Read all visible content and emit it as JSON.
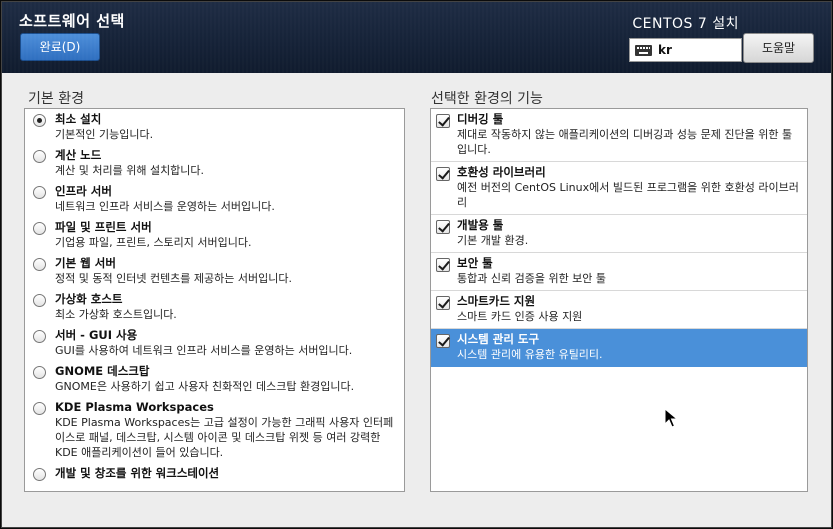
{
  "header": {
    "title": "소프트웨어 선택",
    "done_label": "완료(D)",
    "product": "CENTOS 7 설치",
    "keyboard_layout": "kr",
    "help_label": "도움말"
  },
  "environment": {
    "title": "기본 환경",
    "items": [
      {
        "name": "최소 설치",
        "desc": "기본적인 기능입니다.",
        "selected": true
      },
      {
        "name": "계산 노드",
        "desc": "계산 및 처리를 위해 설치합니다.",
        "selected": false
      },
      {
        "name": "인프라 서버",
        "desc": "네트워크 인프라 서비스를 운영하는 서버입니다.",
        "selected": false
      },
      {
        "name": "파일 및 프린트 서버",
        "desc": "기업용 파일, 프린트, 스토리지 서버입니다.",
        "selected": false
      },
      {
        "name": "기본 웹 서버",
        "desc": "정적 및 동적 인터넷 컨텐츠를 제공하는 서버입니다.",
        "selected": false
      },
      {
        "name": "가상화 호스트",
        "desc": "최소 가상화 호스트입니다.",
        "selected": false
      },
      {
        "name": "서버 - GUI 사용",
        "desc": "GUI를 사용하여 네트워크 인프라 서비스를 운영하는 서버입니다.",
        "selected": false
      },
      {
        "name": "GNOME 데스크탑",
        "desc": "GNOME은 사용하기 쉽고 사용자 친화적인 데스크탑 환경입니다.",
        "selected": false
      },
      {
        "name": "KDE Plasma Workspaces",
        "desc": "KDE Plasma Workspaces는 고급 설정이 가능한 그래픽 사용자 인터페이스로 패널, 데스크탑, 시스템 아이콘 및 데스크탑 위젯 등 여러 강력한 KDE 애플리케이션이 들어 있습니다.",
        "selected": false
      },
      {
        "name": "개발 및 창조를 위한 워크스테이션",
        "desc": "",
        "selected": false
      }
    ]
  },
  "addons": {
    "title": "선택한 환경의 기능",
    "items": [
      {
        "name": "디버깅 툴",
        "desc": "제대로 작동하지 않는 애플리케이션의 디버깅과 성능 문제 진단을 위한 툴입니다.",
        "checked": true,
        "highlighted": false
      },
      {
        "name": "호환성 라이브러리",
        "desc": "예전 버전의 CentOS Linux에서 빌드된 프로그램을 위한 호환성 라이브러리",
        "checked": true,
        "highlighted": false
      },
      {
        "name": "개발용 툴",
        "desc": "기본 개발 환경.",
        "checked": true,
        "highlighted": false
      },
      {
        "name": "보안 툴",
        "desc": "통합과 신뢰 검증을 위한 보안 툴",
        "checked": true,
        "highlighted": false
      },
      {
        "name": "스마트카드 지원",
        "desc": "스마트 카드 인증 사용 지원",
        "checked": true,
        "highlighted": false
      },
      {
        "name": "시스템 관리 도구",
        "desc": "시스템 관리에 유용한 유틸리티.",
        "checked": true,
        "highlighted": true
      }
    ]
  }
}
